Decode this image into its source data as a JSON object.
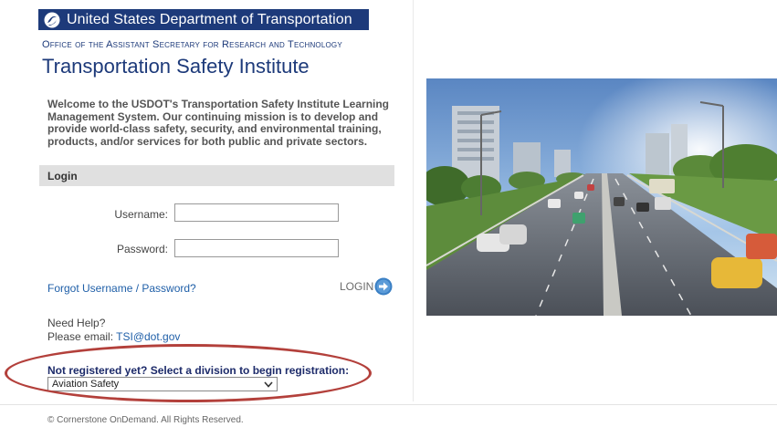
{
  "header": {
    "dot_title": "United States Department of Transportation",
    "office": "Office of the Assistant Secretary for Research and Technology",
    "institute": "Transportation Safety Institute",
    "logo_icon": "dot-logo-icon"
  },
  "welcome": "Welcome to the USDOT's Transportation Safety Institute Learning Management System. Our continuing mission is to develop and provide world-class safety, security, and environmental training, products, and/or services for both public and private sectors.",
  "login": {
    "section_title": "Login",
    "username_label": "Username:",
    "username_value": "",
    "password_label": "Password:",
    "password_value": "",
    "forgot_link": "Forgot Username / Password?",
    "login_button": "LOGIN",
    "login_icon": "arrow-right-circle-icon"
  },
  "help": {
    "label": "Need Help?",
    "email_prefix": "Please email: ",
    "email": "TSI@dot.gov"
  },
  "registration": {
    "prompt": "Not registered yet? Select a division to begin registration:",
    "selected_division": "Aviation Safety"
  },
  "footer": "© Cornerstone OnDemand. All Rights Reserved.",
  "colors": {
    "brand_navy": "#1d3a7a",
    "link_blue": "#1f5fa8",
    "annotation_red": "#b3403b"
  }
}
